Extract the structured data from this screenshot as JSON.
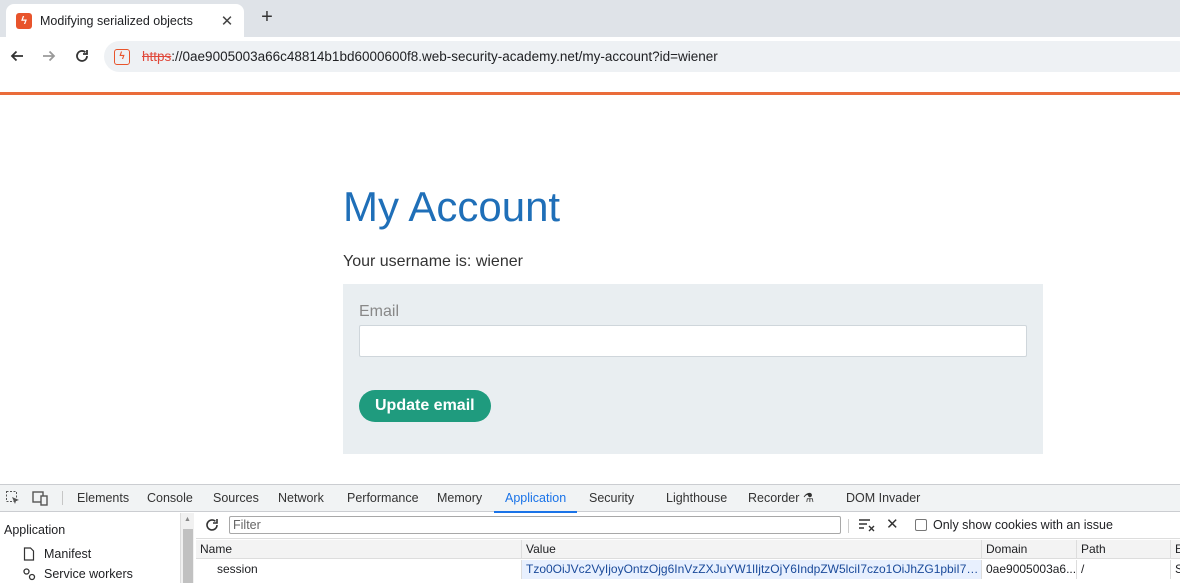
{
  "browser": {
    "tab_title": "Modifying serialized objects",
    "new_tab_label": "+",
    "url_scheme": "https",
    "url_rest": "://0ae9005003a66c48814b1bd6000600f8.web-security-academy.net/my-account?id=wiener"
  },
  "page": {
    "title": "My Account",
    "username_line": "Your username is: wiener",
    "email_label": "Email",
    "email_value": "",
    "update_button": "Update email",
    "accent_color": "#ea6c3a",
    "title_color": "#1f6fb8",
    "button_color": "#1f9b7e"
  },
  "devtools": {
    "tabs": [
      "Elements",
      "Console",
      "Sources",
      "Network",
      "Performance",
      "Memory",
      "Application",
      "Security",
      "Lighthouse",
      "Recorder",
      "DOM Invader"
    ],
    "active_tab": "Application",
    "sidebar": {
      "heading": "Application",
      "items": [
        {
          "label": "Manifest",
          "icon": "document-icon"
        },
        {
          "label": "Service workers",
          "icon": "gears-icon"
        }
      ]
    },
    "filter_placeholder": "Filter",
    "only_issue_label": "Only show cookies with an issue",
    "only_issue_checked": false,
    "columns": [
      "Name",
      "Value",
      "Domain",
      "Path",
      "E"
    ],
    "rows": [
      {
        "name": "session",
        "value": "Tzo0OiJVc2VyIjoyOntzOjg6InVzZXJuYW1lIjtzOjY6IndpZW5lciI7czo1OiJhZG1pbiI7Yjo...",
        "domain": "0ae9005003a6...",
        "path": "/",
        "extra": "S"
      }
    ]
  }
}
